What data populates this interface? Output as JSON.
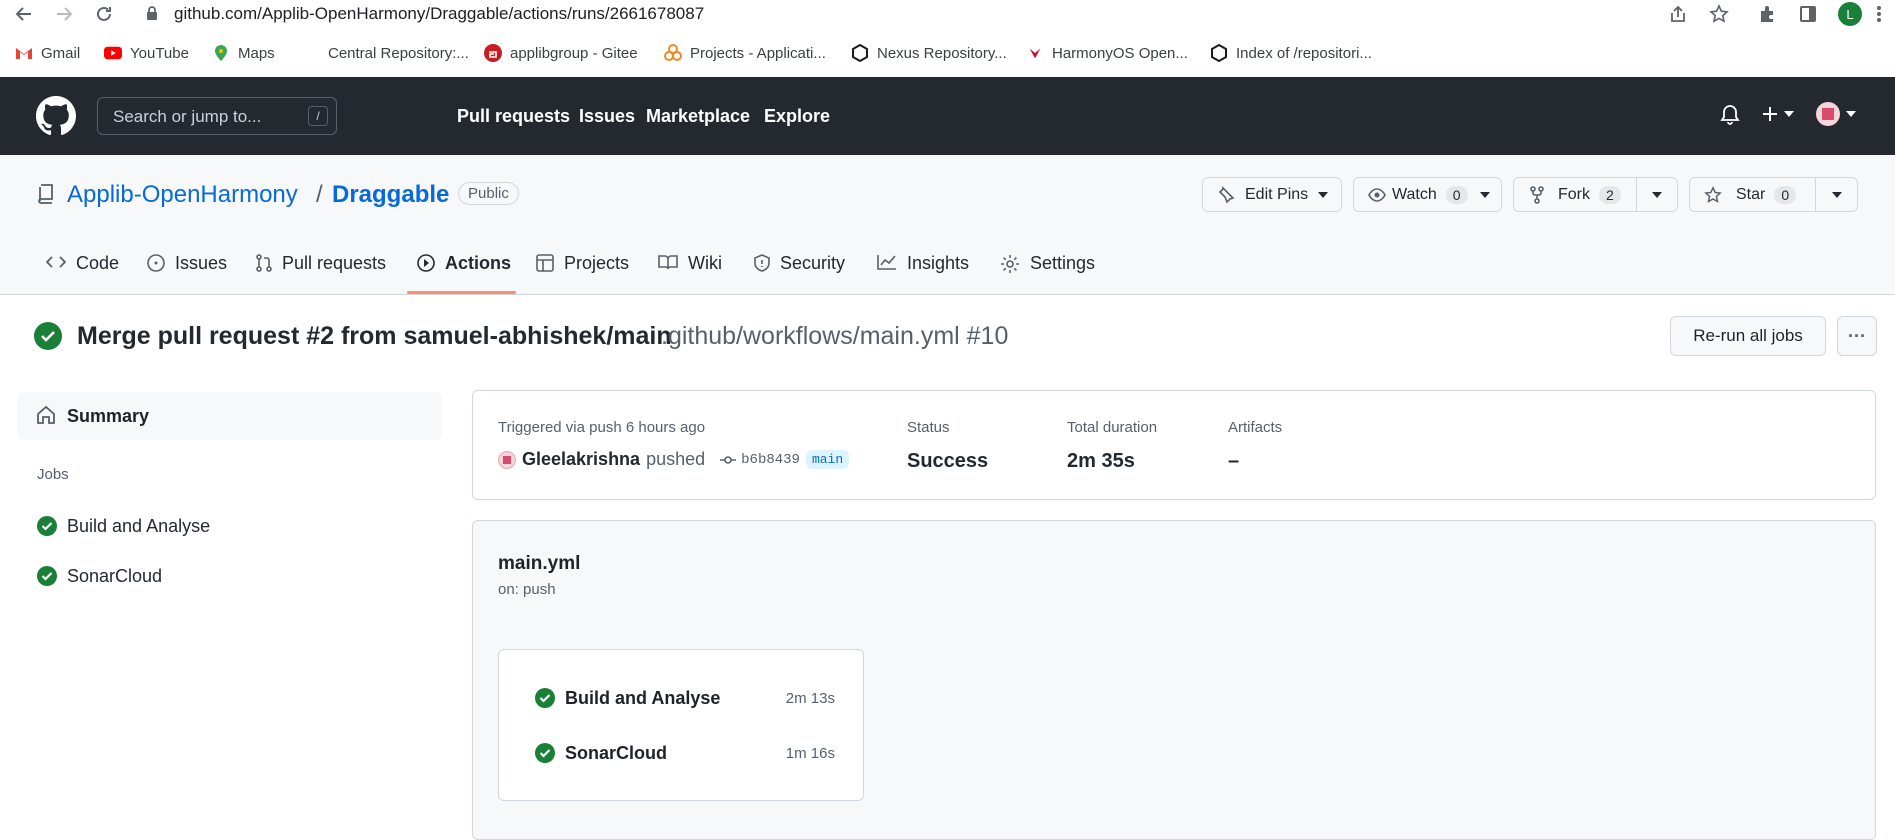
{
  "browser": {
    "url": "github.com/Applib-OpenHarmony/Draggable/actions/runs/2661678087",
    "profile_initial": "L",
    "bookmarks": [
      "Gmail",
      "YouTube",
      "Maps",
      "Central Repository:...",
      "applibgroup - Gitee",
      "Projects - Applicati...",
      "Nexus Repository...",
      "HarmonyOS Open...",
      "Index of /repositori..."
    ]
  },
  "gh": {
    "search_placeholder": "Search or jump to...",
    "search_key": "/",
    "nav": [
      "Pull requests",
      "Issues",
      "Marketplace",
      "Explore"
    ]
  },
  "repo": {
    "owner": "Applib-OpenHarmony",
    "separator": "/",
    "name": "Draggable",
    "visibility": "Public",
    "edit_pins": "Edit Pins",
    "watch": "Watch",
    "watch_count": "0",
    "fork": "Fork",
    "fork_count": "2",
    "star": "Star",
    "star_count": "0",
    "tabs": [
      "Code",
      "Issues",
      "Pull requests",
      "Actions",
      "Projects",
      "Wiki",
      "Security",
      "Insights",
      "Settings"
    ]
  },
  "run": {
    "title": "Merge pull request #2 from samuel-abhishek/main",
    "path": ".github/workflows/main.yml #10",
    "rerun_label": "Re-run all jobs",
    "more": "···"
  },
  "sidebar": {
    "summary": "Summary",
    "jobs_header": "Jobs",
    "jobs": [
      "Build and Analyse",
      "SonarCloud"
    ]
  },
  "summary": {
    "triggered": "Triggered via push 6 hours ago",
    "actor": "Gleelakrishna",
    "action": "pushed",
    "commit": "b6b8439",
    "branch": "main",
    "status_label": "Status",
    "status_value": "Success",
    "duration_label": "Total duration",
    "duration_value": "2m 35s",
    "artifacts_label": "Artifacts",
    "artifacts_value": "–"
  },
  "workflow": {
    "file": "main.yml",
    "trigger": "on: push",
    "jobs": [
      {
        "name": "Build and Analyse",
        "duration": "2m 13s"
      },
      {
        "name": "SonarCloud",
        "duration": "1m 16s"
      }
    ]
  },
  "colors": {
    "success": "#1a7f37",
    "link": "#0969da",
    "header": "#24292f",
    "tab_active": "#fd8c73"
  }
}
